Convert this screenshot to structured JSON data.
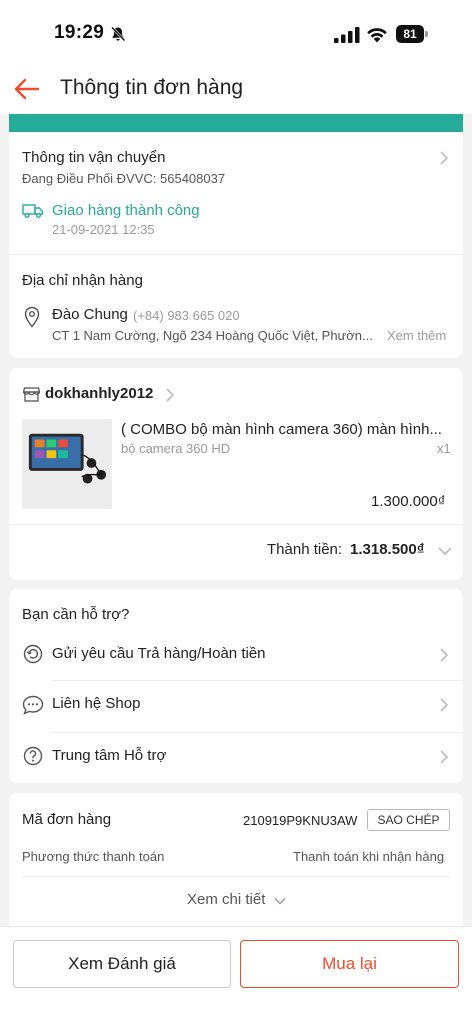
{
  "status_bar": {
    "time": "19:29",
    "battery": "81"
  },
  "header": {
    "title": "Thông tin đơn hàng"
  },
  "shipping": {
    "title": "Thông tin vận chuyển",
    "carrier_info": "Đang Điều Phối ĐVVC: 565408037",
    "status": "Giao hàng thành công",
    "status_time": "21-09-2021 12:35",
    "status_color": "#26aa99"
  },
  "address": {
    "title": "Địa chỉ nhận hàng",
    "name": "Đào Chung",
    "phone": "(+84) 983 665 020",
    "line": "CT 1 Nam Cường, Ngõ 234 Hoàng Quốc Việt, Phườn...",
    "more": "Xem thêm"
  },
  "shop": {
    "name": "dokhanhly2012",
    "product_title": "( COMBO bộ màn hình camera 360) màn hình...",
    "variant": "bộ camera 360 HD",
    "qty": "x1",
    "price": "1.300.000₫",
    "total_label": "Thành tiền:",
    "total_value": "1.318.500₫"
  },
  "support": {
    "title": "Bạn cần hỗ trợ?",
    "items": [
      {
        "label": "Gửi yêu cầu Trả hàng/Hoàn tiền"
      },
      {
        "label": "Liên hệ Shop"
      },
      {
        "label": "Trung tâm Hỗ trợ"
      }
    ]
  },
  "order": {
    "id_label": "Mã đơn hàng",
    "id_value": "210919P9KNU3AW",
    "copy_label": "SAO CHÉP",
    "payment_label": "Phương thức thanh toán",
    "payment_value": "Thanh toán khi nhận hàng",
    "details_label": "Xem chi tiết"
  },
  "actions": {
    "review": "Xem Đánh giá",
    "rebuy": "Mua lại"
  },
  "colors": {
    "accent": "#ee4d2d",
    "teal": "#26aa99"
  }
}
